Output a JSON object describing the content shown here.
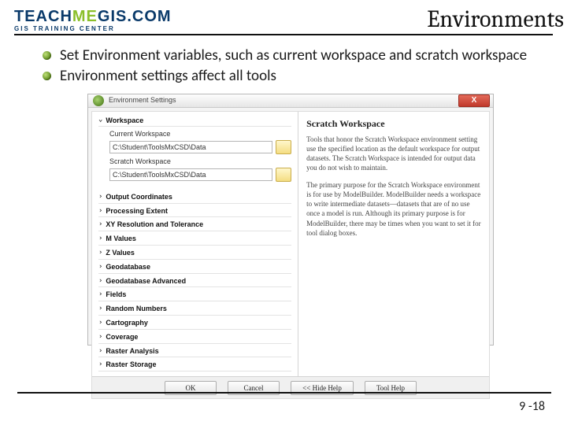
{
  "logo": {
    "teach": "TEACH",
    "me": "ME",
    "gis": "GIS",
    "dotcom": ".COM",
    "subtitle": "GIS  TRAINING  CENTER"
  },
  "title": "Environments",
  "bullets": [
    "Set Environment variables, such as current workspace and scratch workspace",
    "Environment settings affect all tools"
  ],
  "dialog": {
    "title": "Environment Settings",
    "close": "X",
    "workspace": {
      "header": "Workspace",
      "currentLabel": "Current Workspace",
      "currentValue": "C:\\Student\\ToolsMxCSD\\Data",
      "scratchLabel": "Scratch Workspace",
      "scratchValue": "C:\\Student\\ToolsMxCSD\\Data"
    },
    "sections": [
      "Output Coordinates",
      "Processing Extent",
      "XY Resolution and Tolerance",
      "M Values",
      "Z Values",
      "Geodatabase",
      "Geodatabase Advanced",
      "Fields",
      "Random Numbers",
      "Cartography",
      "Coverage",
      "Raster Analysis",
      "Raster Storage"
    ],
    "help": {
      "heading": "Scratch Workspace",
      "p1": "Tools that honor the Scratch Workspace environment setting use the specified location as the default workspace for output datasets. The Scratch Workspace is intended for output data you do not wish to maintain.",
      "p2": "The primary purpose for the Scratch Workspace environment is for use by ModelBuilder. ModelBuilder needs a workspace to write intermediate datasets—datasets that are of no use once a model is run. Although its primary purpose is for ModelBuilder, there may be times when you want to set it for tool dialog boxes."
    },
    "buttons": {
      "ok": "OK",
      "cancel": "Cancel",
      "hide": "<< Hide Help",
      "toolhelp": "Tool Help"
    }
  },
  "page": "9 -18"
}
